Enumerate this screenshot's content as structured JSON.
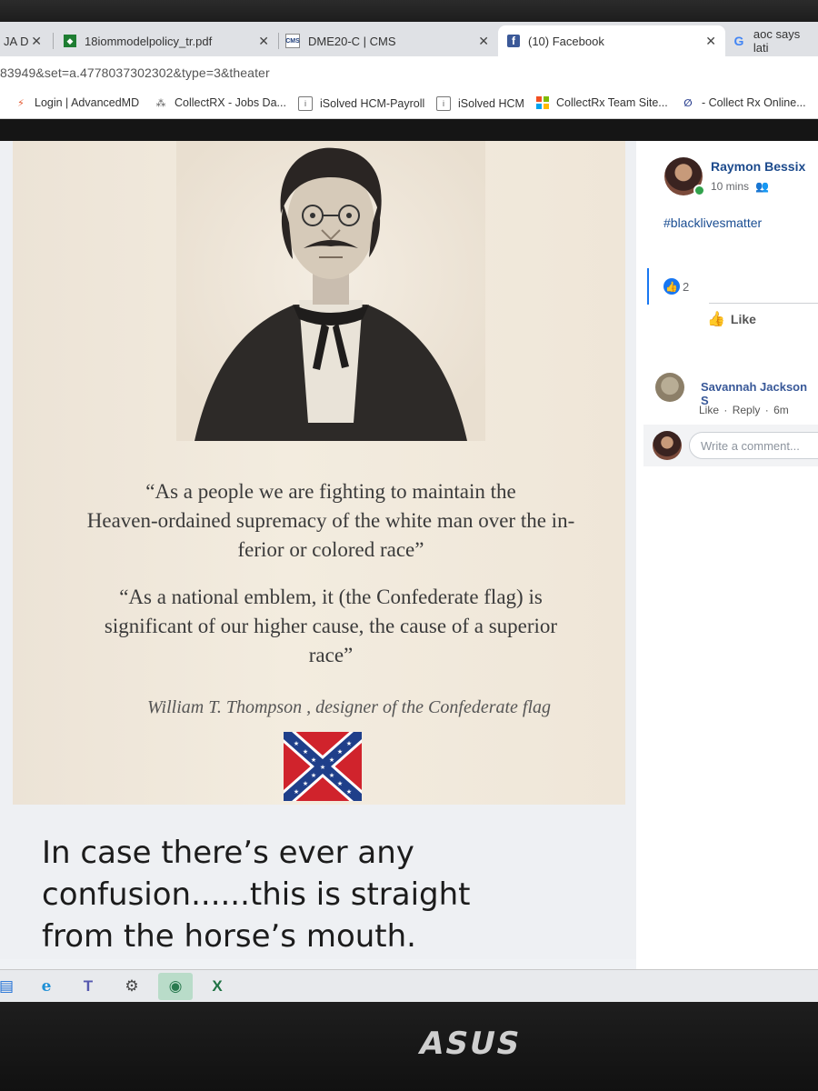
{
  "browser": {
    "tabs": [
      {
        "label": "JA D",
        "favicon": "generic",
        "active": false
      },
      {
        "label": "18iommodelpolicy_tr.pdf",
        "favicon": "pdf-icon",
        "active": false
      },
      {
        "label": "DME20-C | CMS",
        "favicon": "cms-icon",
        "active": false
      },
      {
        "label": "(10) Facebook",
        "favicon": "facebook-icon",
        "active": true
      },
      {
        "label": "aoc says lati",
        "favicon": "google-icon",
        "active": false
      }
    ],
    "url": "83949&set=a.4778037302302&type=3&theater",
    "bookmarks": [
      {
        "label": "Login | AdvancedMD",
        "icon": "advancedmd-icon"
      },
      {
        "label": "CollectRX - Jobs Da...",
        "icon": "dots-icon"
      },
      {
        "label": "iSolved HCM-Payroll",
        "icon": "info-icon"
      },
      {
        "label": "iSolved HCM",
        "icon": "info-icon"
      },
      {
        "label": "CollectRx Team Site...",
        "icon": "microsoft-icon"
      },
      {
        "label": "- Collect Rx Online...",
        "icon": "paperclip-icon"
      }
    ]
  },
  "post_image": {
    "quote1": "“As a people we are fighting to maintain the Heaven-ordained supremacy of the white man over the in-ferior or colored race”",
    "quote1_lines": [
      "“As a people we are fighting to maintain the",
      "Heaven-ordained supremacy of the white man over the in-",
      "ferior or colored race”"
    ],
    "quote2_lines": [
      "“As a national emblem, it (the Confederate flag) is",
      "significant of our higher cause, the cause of a superior",
      "race”"
    ],
    "attribution": "William T. Thompson , designer of the Confederate flag",
    "caption_lines": [
      "In case there’s ever any",
      "confusion......this is straight",
      "from the horse’s mouth."
    ]
  },
  "post_panel": {
    "poster_name": "Raymon Bessix",
    "time": "10 mins",
    "audience_icon": "friends-icon",
    "hashtag": "#blacklivesmatter",
    "reaction_icon": "like-reaction-icon",
    "reaction_count": "2",
    "like_label": "Like",
    "comment": {
      "author": "Savannah Jackson S",
      "actions": [
        "Like",
        "Reply",
        "6m"
      ]
    },
    "write_placeholder": "Write a comment..."
  },
  "taskbar": {
    "icons": [
      "file-explorer-icon",
      "internet-explorer-icon",
      "teams-icon",
      "settings-icon",
      "messaging-icon",
      "excel-icon"
    ]
  },
  "monitor": {
    "brand": "ASUS"
  },
  "colors": {
    "facebook_blue": "#1877f2",
    "name_blue": "#385898",
    "flag_red": "#d0232c",
    "flag_blue": "#1f3f8a"
  }
}
